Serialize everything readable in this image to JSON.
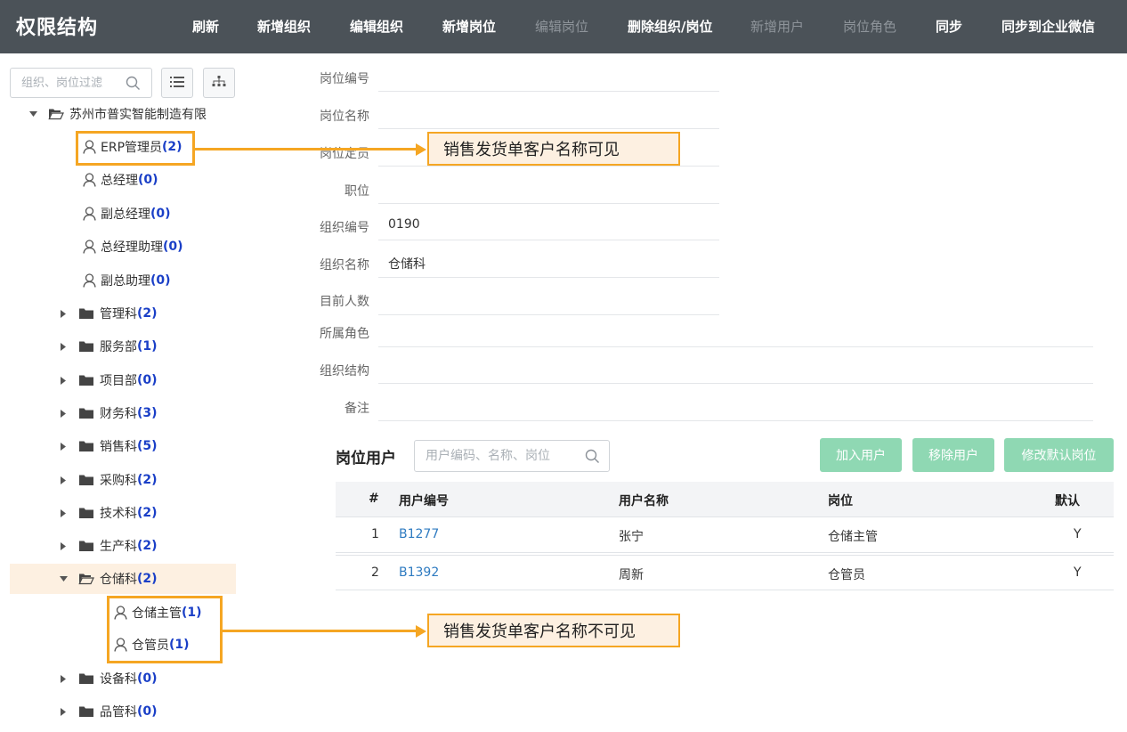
{
  "topbar": {
    "title": "权限结构",
    "menu": [
      {
        "label": "刷新",
        "enabled": true
      },
      {
        "label": "新增组织",
        "enabled": true
      },
      {
        "label": "编辑组织",
        "enabled": true
      },
      {
        "label": "新增岗位",
        "enabled": true
      },
      {
        "label": "编辑岗位",
        "enabled": false
      },
      {
        "label": "删除组织/岗位",
        "enabled": true
      },
      {
        "label": "新增用户",
        "enabled": false
      },
      {
        "label": "岗位角色",
        "enabled": false
      },
      {
        "label": "同步",
        "enabled": true
      },
      {
        "label": "同步到企业微信",
        "enabled": true
      }
    ]
  },
  "sidebar": {
    "search_placeholder": "组织、岗位过滤",
    "tree": [
      {
        "label": "苏州市普实智能制造有限",
        "count": ""
      },
      {
        "label": "ERP管理员",
        "count": "(2)"
      },
      {
        "label": "总经理",
        "count": "(0)"
      },
      {
        "label": "副总经理",
        "count": "(0)"
      },
      {
        "label": "总经理助理",
        "count": "(0)"
      },
      {
        "label": "副总助理",
        "count": "(0)"
      },
      {
        "label": "管理科",
        "count": "(2)"
      },
      {
        "label": "服务部",
        "count": "(1)"
      },
      {
        "label": "项目部",
        "count": "(0)"
      },
      {
        "label": "财务科",
        "count": "(3)"
      },
      {
        "label": "销售科",
        "count": "(5)"
      },
      {
        "label": "采购科",
        "count": "(2)"
      },
      {
        "label": "技术科",
        "count": "(2)"
      },
      {
        "label": "生产科",
        "count": "(2)"
      },
      {
        "label": "仓储科",
        "count": "(2)"
      },
      {
        "label": "仓储主管",
        "count": "(1)"
      },
      {
        "label": "仓管员",
        "count": "(1)"
      },
      {
        "label": "设备科",
        "count": "(0)"
      },
      {
        "label": "品管科",
        "count": "(0)"
      }
    ]
  },
  "callouts": {
    "visible": "销售发货单客户名称可见",
    "invisible": "销售发货单客户名称不可见"
  },
  "form": {
    "fields": [
      {
        "label": "岗位编号",
        "value": ""
      },
      {
        "label": "岗位名称",
        "value": ""
      },
      {
        "label": "岗位定员",
        "value": ""
      },
      {
        "label": "职位",
        "value": ""
      },
      {
        "label": "组织编号",
        "value": "0190"
      },
      {
        "label": "组织名称",
        "value": "仓储科"
      },
      {
        "label": "目前人数",
        "value": ""
      },
      {
        "label": "所属角色",
        "value": ""
      },
      {
        "label": "组织结构",
        "value": ""
      },
      {
        "label": "备注",
        "value": ""
      }
    ]
  },
  "users": {
    "title": "岗位用户",
    "search_placeholder": "用户编码、名称、岗位",
    "buttons": {
      "add": "加入用户",
      "remove": "移除用户",
      "default": "修改默认岗位"
    },
    "columns": [
      "#",
      "用户编号",
      "用户名称",
      "岗位",
      "默认"
    ],
    "rows": [
      {
        "index": "1",
        "code": "B1277",
        "name": "张宁",
        "post": "仓储主管",
        "default": "Y"
      },
      {
        "index": "2",
        "code": "B1392",
        "name": "周新",
        "post": "仓管员",
        "default": "Y"
      }
    ]
  },
  "colors": {
    "topbar": "#4b5258",
    "highlight": "#f5a623",
    "count": "#1a3fc7",
    "button": "#8fd8b3",
    "link": "#2f7bc1"
  }
}
